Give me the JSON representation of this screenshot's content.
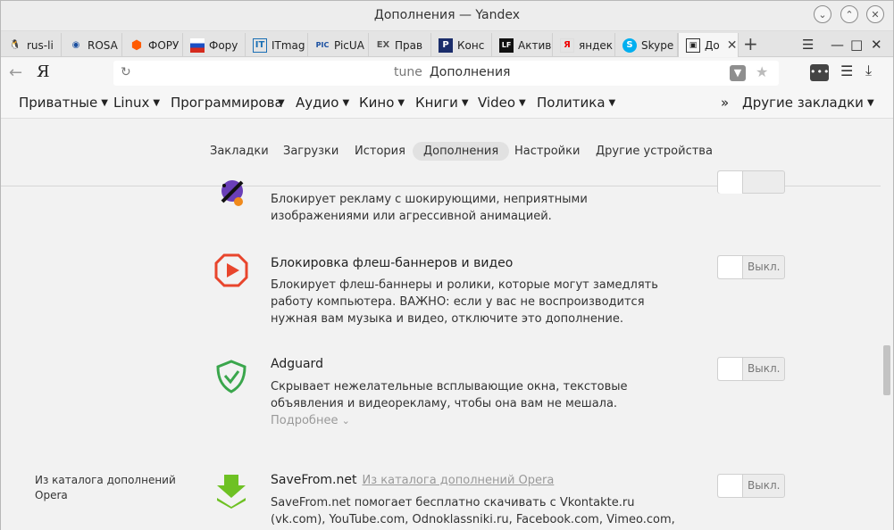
{
  "window": {
    "title": "Дополнения — Yandex"
  },
  "tabs": [
    {
      "label": "rus-li",
      "icon": "tux-icon"
    },
    {
      "label": "ROSA",
      "icon": "rosa-icon"
    },
    {
      "label": "ФОРУ",
      "icon": "orange-hex-icon"
    },
    {
      "label": "Фору",
      "icon": "flag-icon"
    },
    {
      "label": "ITmag",
      "icon": "it-icon"
    },
    {
      "label": "PicUA",
      "icon": "picua-icon"
    },
    {
      "label": "Прав",
      "icon": "ex-icon"
    },
    {
      "label": "Конс",
      "icon": "p-icon"
    },
    {
      "label": "Актив",
      "icon": "lf-icon"
    },
    {
      "label": "яндек",
      "icon": "yandex-icon"
    },
    {
      "label": "Skype",
      "icon": "skype-icon"
    },
    {
      "label": "До",
      "icon": "addons-icon",
      "active": true
    }
  ],
  "address": {
    "host": "tune",
    "title": "Дополнения",
    "ya": "Я"
  },
  "bookmarks": [
    {
      "label": "Приватные"
    },
    {
      "label": "Linux"
    },
    {
      "label": "Программирова"
    },
    {
      "label": "Аудио"
    },
    {
      "label": "Кино"
    },
    {
      "label": "Книги"
    },
    {
      "label": "Video"
    },
    {
      "label": "Политика"
    }
  ],
  "bookmarks_other": "Другие закладки",
  "page_nav": [
    {
      "label": "Закладки"
    },
    {
      "label": "Загрузки"
    },
    {
      "label": "История"
    },
    {
      "label": "Дополнения",
      "active": true
    },
    {
      "label": "Настройки"
    },
    {
      "label": "Другие устройства"
    }
  ],
  "extensions": [
    {
      "name": "",
      "description": "Блокирует рекламу с шокирующими, неприятными изображениями или агрессивной анимацией.",
      "toggle": ""
    },
    {
      "name": "Блокировка флеш-баннеров и видео",
      "description": "Блокирует флеш-баннеры и ролики, которые могут замедлять работу компьютера. ВАЖНО: если у вас не воспроизводится нужная вам музыка и видео, отключите это дополнение.",
      "toggle": "Выкл."
    },
    {
      "name": "Adguard",
      "description": "Скрывает нежелательные всплывающие окна, текстовые объявления и видеорекламу, чтобы она вам не мешала.",
      "more": "Подробнее",
      "toggle": "Выкл."
    },
    {
      "name": "SaveFrom.net",
      "source": "Из каталога дополнений Opera",
      "description": "SaveFrom.net помогает бесплатно скачивать с Vkontakte.ru (vk.com), YouTube.com, Odnoklassniki.ru, Facebook.com, Vimeo.com, Soundcloud.com и",
      "toggle": "Выкл."
    }
  ],
  "catalog_section": "Из каталога дополнений Opera"
}
